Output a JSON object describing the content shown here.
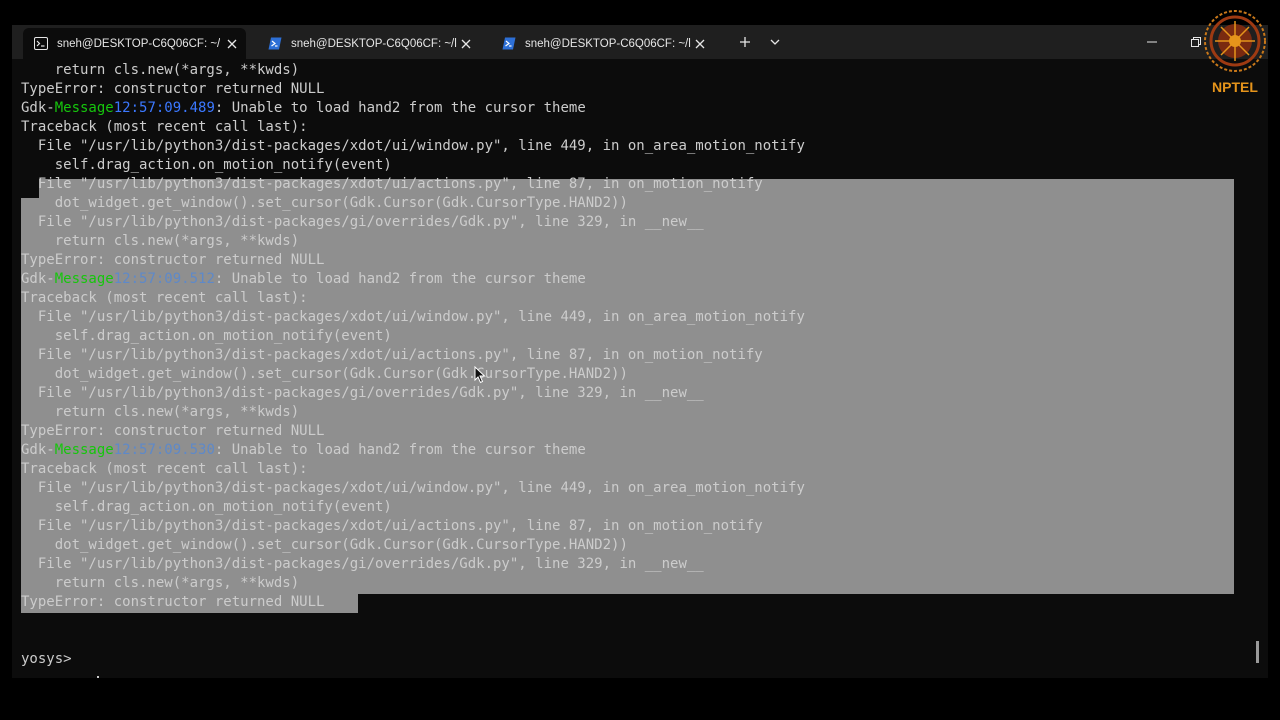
{
  "tabs": [
    {
      "label": "sneh@DESKTOP-C6Q06CF: ~/",
      "icon": "terminal-icon",
      "active": true
    },
    {
      "label": "sneh@DESKTOP-C6Q06CF: ~/l",
      "icon": "powershell-icon",
      "active": false
    },
    {
      "label": "sneh@DESKTOP-C6Q06CF: ~/l",
      "icon": "powershell-icon",
      "active": false
    }
  ],
  "toolbar": {
    "new_tab": "+",
    "dropdown": "⌄"
  },
  "colors": {
    "terminal_bg": "#0c0c0c",
    "text": "#cccccc",
    "selection": "#8f8f8f",
    "gdk_green": "#16c60c",
    "timestamp_blue": "#3b78ff",
    "logo_orange": "#e5941b"
  },
  "terminal": {
    "lines": [
      {
        "text": "    return cls.new(*args, **kwds)"
      },
      {
        "text": "TypeError: constructor returned NULL"
      },
      {
        "pre": "Gdk-",
        "tag": "Message",
        "ts": "12:57:09.489",
        "post": ": Unable to load hand2 from the cursor theme"
      },
      {
        "text": "Traceback (most recent call last):"
      },
      {
        "text": "  File \"/usr/lib/python3/dist-packages/xdot/ui/window.py\", line 449, in on_area_motion_notify"
      },
      {
        "text": "    self.drag_action.on_motion_notify(event)"
      },
      {
        "text": "  File \"/usr/lib/python3/dist-packages/xdot/ui/actions.py\", line 87, in on_motion_notify"
      },
      {
        "text": "    dot_widget.get_window().set_cursor(Gdk.Cursor(Gdk.CursorType.HAND2))"
      },
      {
        "text": "  File \"/usr/lib/python3/dist-packages/gi/overrides/Gdk.py\", line 329, in __new__"
      },
      {
        "text": "    return cls.new(*args, **kwds)"
      },
      {
        "text": "TypeError: constructor returned NULL"
      },
      {
        "pre": "Gdk-",
        "tag": "Message",
        "ts": "12:57:09.512",
        "post": ": Unable to load hand2 from the cursor theme"
      },
      {
        "text": "Traceback (most recent call last):"
      },
      {
        "text": "  File \"/usr/lib/python3/dist-packages/xdot/ui/window.py\", line 449, in on_area_motion_notify"
      },
      {
        "text": "    self.drag_action.on_motion_notify(event)"
      },
      {
        "text": "  File \"/usr/lib/python3/dist-packages/xdot/ui/actions.py\", line 87, in on_motion_notify"
      },
      {
        "text": "    dot_widget.get_window().set_cursor(Gdk.Cursor(Gdk.CursorType.HAND2))"
      },
      {
        "text": "  File \"/usr/lib/python3/dist-packages/gi/overrides/Gdk.py\", line 329, in __new__"
      },
      {
        "text": "    return cls.new(*args, **kwds)"
      },
      {
        "text": "TypeError: constructor returned NULL"
      },
      {
        "pre": "Gdk-",
        "tag": "Message",
        "ts": "12:57:09.530",
        "post": ": Unable to load hand2 from the cursor theme"
      },
      {
        "text": "Traceback (most recent call last):"
      },
      {
        "text": "  File \"/usr/lib/python3/dist-packages/xdot/ui/window.py\", line 449, in on_area_motion_notify"
      },
      {
        "text": "    self.drag_action.on_motion_notify(event)"
      },
      {
        "text": "  File \"/usr/lib/python3/dist-packages/xdot/ui/actions.py\", line 87, in on_motion_notify"
      },
      {
        "text": "    dot_widget.get_window().set_cursor(Gdk.Cursor(Gdk.CursorType.HAND2))"
      },
      {
        "text": "  File \"/usr/lib/python3/dist-packages/gi/overrides/Gdk.py\", line 329, in __new__"
      },
      {
        "text": "    return cls.new(*args, **kwds)"
      },
      {
        "text": "TypeError: constructor returned NULL"
      },
      {
        "text": ""
      },
      {
        "text": ""
      },
      {
        "text": "yosys> "
      }
    ],
    "prompt": "yosys> "
  },
  "logo": {
    "text": "NPTEL"
  }
}
